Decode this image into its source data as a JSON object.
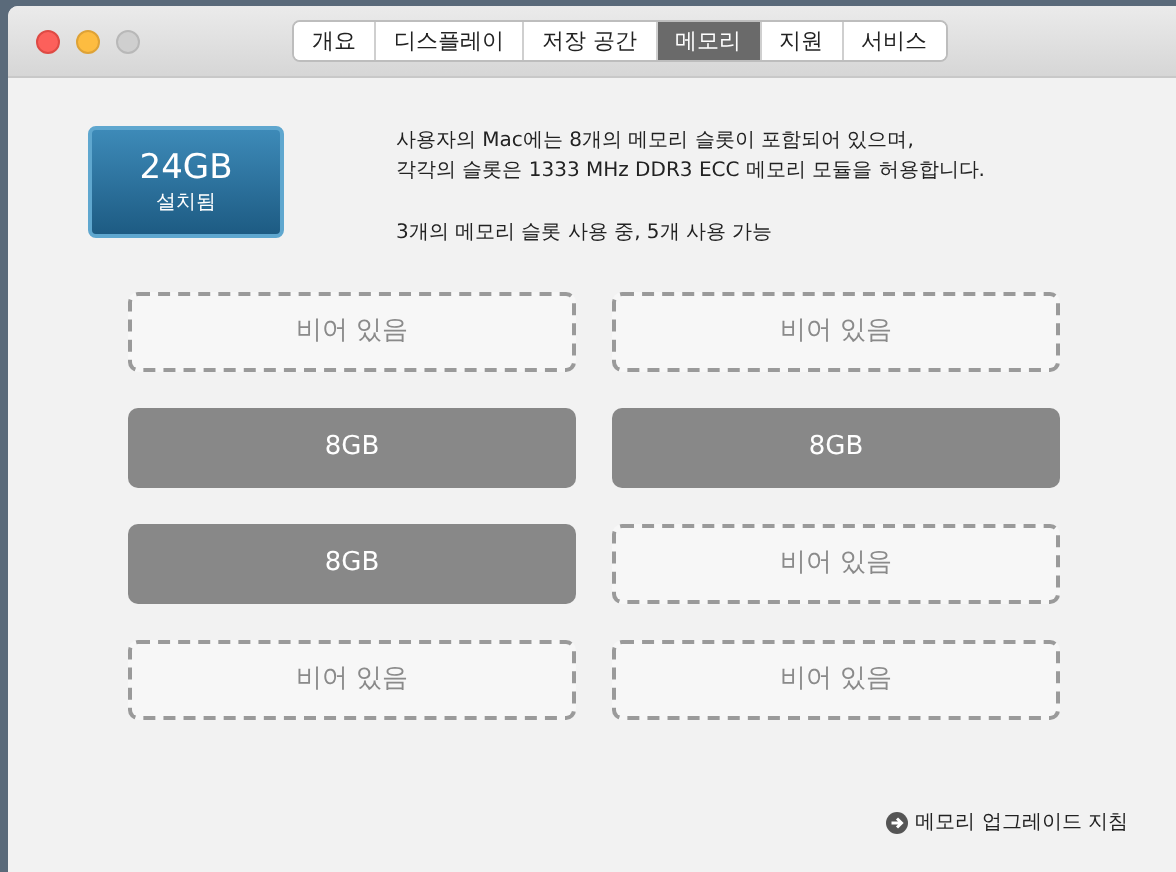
{
  "window": {
    "buttons": [
      {
        "kind": "close",
        "disabled": false
      },
      {
        "kind": "minimize",
        "disabled": false
      },
      {
        "kind": "zoom",
        "disabled": true
      }
    ]
  },
  "tabs": [
    {
      "label": "개요",
      "selected": false
    },
    {
      "label": "디스플레이",
      "selected": false
    },
    {
      "label": "저장 공간",
      "selected": false
    },
    {
      "label": "메모리",
      "selected": true
    },
    {
      "label": "지원",
      "selected": false
    },
    {
      "label": "서비스",
      "selected": false
    }
  ],
  "memory": {
    "size": "24GB",
    "caption": "설치됨",
    "description": [
      "사용자의 Mac에는 8개의 메모리 슬롯이 포함되어 있으며,",
      "각각의 슬롯은 1333 MHz DDR3 ECC 메모리 모듈을 허용합니다."
    ],
    "usage": "3개의 메모리 슬롯 사용 중, 5개 사용 가능"
  },
  "slots": [
    {
      "kind": "empty",
      "label": "비어 있음"
    },
    {
      "kind": "empty",
      "label": "비어 있음"
    },
    {
      "kind": "filled",
      "label": "8GB"
    },
    {
      "kind": "filled",
      "label": "8GB"
    },
    {
      "kind": "filled",
      "label": "8GB"
    },
    {
      "kind": "empty",
      "label": "비어 있음"
    },
    {
      "kind": "empty",
      "label": "비어 있음"
    },
    {
      "kind": "empty",
      "label": "비어 있음"
    }
  ],
  "upgrade_link": "메모리 업그레이드 지침"
}
